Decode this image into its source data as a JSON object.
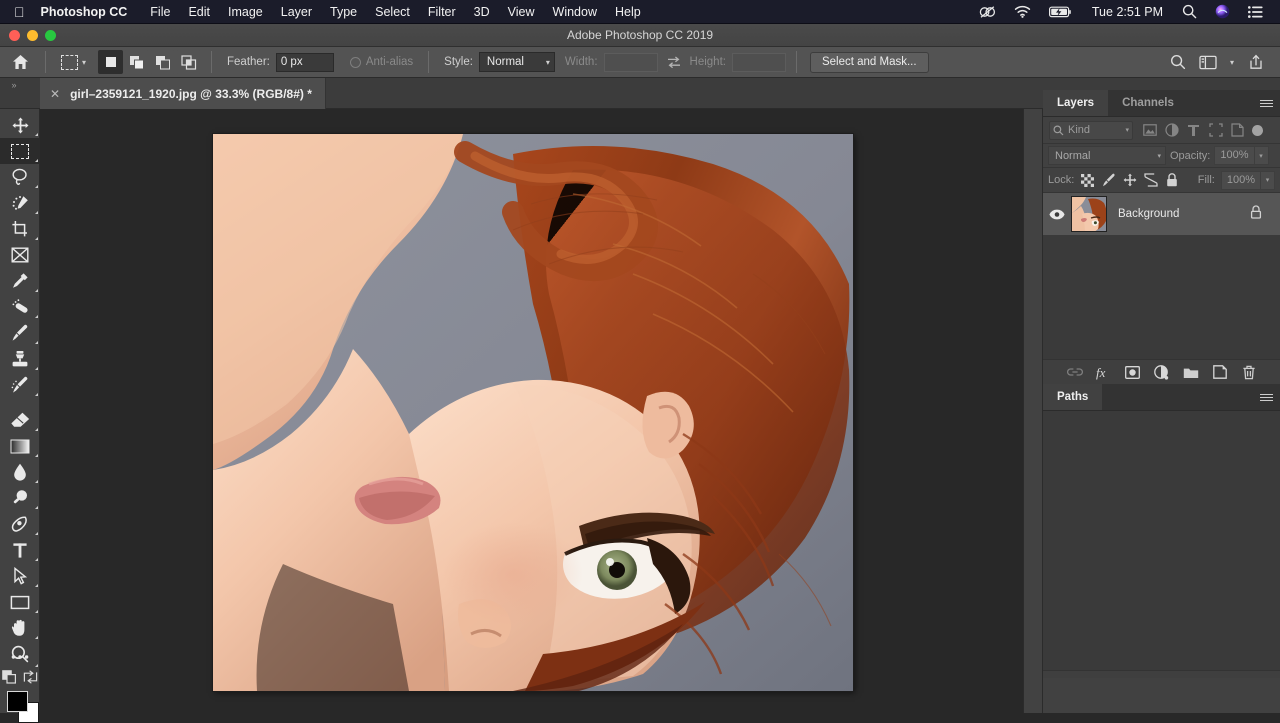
{
  "menubar": {
    "apple_icon": "apple-logo-icon",
    "app_name": "Photoshop CC",
    "items": [
      "File",
      "Edit",
      "Image",
      "Layer",
      "Type",
      "Select",
      "Filter",
      "3D",
      "View",
      "Window",
      "Help"
    ],
    "tray": {
      "creative_cloud_icon": "creative-cloud-icon",
      "wifi_icon": "wifi-icon",
      "battery_icon": "battery-charging-icon",
      "clock": "Tue 2:51 PM",
      "search_icon": "spotlight-search-icon",
      "siri_icon": "siri-icon",
      "notification_icon": "notification-center-icon"
    }
  },
  "titlebar": {
    "title": "Adobe Photoshop CC 2019",
    "close_color": "#ff5f57",
    "minimize_color": "#febc2e",
    "maximize_color": "#28c840"
  },
  "options_bar": {
    "home_icon": "home-icon",
    "active_tool_icon": "rectangular-marquee-icon",
    "tool_chevron_icon": "chevron-down-icon",
    "selection_modes": [
      {
        "name": "new-selection",
        "icon": "new-selection-icon",
        "active": true
      },
      {
        "name": "add-to-selection",
        "icon": "add-to-selection-icon",
        "active": false
      },
      {
        "name": "subtract-from-selection",
        "icon": "subtract-from-selection-icon",
        "active": false
      },
      {
        "name": "intersect-with-selection",
        "icon": "intersect-selection-icon",
        "active": false
      }
    ],
    "feather_label": "Feather:",
    "feather_value": "0 px",
    "antialias_label": "Anti-alias",
    "antialias_enabled": false,
    "style_label": "Style:",
    "style_value": "Normal",
    "width_label": "Width:",
    "width_value": "",
    "swap_icon": "swap-width-height-icon",
    "height_label": "Height:",
    "height_value": "",
    "select_and_mask_label": "Select and Mask...",
    "right_icons": [
      "search-icon",
      "workspace-icon",
      "chevron-down-icon",
      "share-icon"
    ]
  },
  "tab_bar": {
    "expand_icon": "expand-panel-arrows-icon",
    "document": {
      "close_icon": "close-icon",
      "title": "girl–2359121_1920.jpg @ 33.3% (RGB/8#) *"
    }
  },
  "toolbar": {
    "tools": [
      {
        "name": "move-tool",
        "icon": "move-icon",
        "selected": false,
        "has_submenu": true
      },
      {
        "name": "rectangular-marquee-tool",
        "icon": "rectangular-marquee-icon",
        "selected": true,
        "has_submenu": true
      },
      {
        "name": "lasso-tool",
        "icon": "lasso-icon",
        "selected": false,
        "has_submenu": true
      },
      {
        "name": "quick-selection-tool",
        "icon": "quick-selection-icon",
        "selected": false,
        "has_submenu": true
      },
      {
        "name": "crop-tool",
        "icon": "crop-icon",
        "selected": false,
        "has_submenu": true
      },
      {
        "name": "frame-tool",
        "icon": "frame-icon",
        "selected": false,
        "has_submenu": false
      },
      {
        "name": "eyedropper-tool",
        "icon": "eyedropper-icon",
        "selected": false,
        "has_submenu": true
      },
      {
        "name": "spot-healing-brush-tool",
        "icon": "healing-brush-icon",
        "selected": false,
        "has_submenu": true
      },
      {
        "name": "brush-tool",
        "icon": "brush-icon",
        "selected": false,
        "has_submenu": true
      },
      {
        "name": "clone-stamp-tool",
        "icon": "clone-stamp-icon",
        "selected": false,
        "has_submenu": true
      },
      {
        "name": "history-brush-tool",
        "icon": "history-brush-icon",
        "selected": false,
        "has_submenu": true
      },
      {
        "name": "eraser-tool",
        "icon": "eraser-icon",
        "selected": false,
        "has_submenu": true
      },
      {
        "name": "gradient-tool",
        "icon": "gradient-icon",
        "selected": false,
        "has_submenu": true
      },
      {
        "name": "blur-tool",
        "icon": "blur-droplet-icon",
        "selected": false,
        "has_submenu": true
      },
      {
        "name": "dodge-tool",
        "icon": "dodge-icon",
        "selected": false,
        "has_submenu": true
      },
      {
        "name": "pen-tool",
        "icon": "pen-icon",
        "selected": false,
        "has_submenu": true
      },
      {
        "name": "type-tool",
        "icon": "type-t-icon",
        "selected": false,
        "has_submenu": true
      },
      {
        "name": "path-selection-tool",
        "icon": "path-selection-arrow-icon",
        "selected": false,
        "has_submenu": true
      },
      {
        "name": "rectangle-tool",
        "icon": "rectangle-icon",
        "selected": false,
        "has_submenu": true
      },
      {
        "name": "hand-tool",
        "icon": "hand-icon",
        "selected": false,
        "has_submenu": true
      },
      {
        "name": "zoom-tool",
        "icon": "zoom-magnifier-icon",
        "selected": false,
        "has_submenu": false
      },
      {
        "name": "edit-toolbar-more",
        "icon": "ellipsis-more-tools-icon",
        "selected": false,
        "has_submenu": true
      }
    ],
    "quick_mask_icon": "quick-mask-icon",
    "screen_mode_icon": "screen-mode-icon",
    "foreground_color": "#000000",
    "background_color": "#ffffff"
  },
  "canvas": {
    "zoom": "33.3%",
    "background_color": "#8a8d98",
    "document_name": "girl–2359121_1920.jpg",
    "image_description": "Rotated portrait photograph of a red-haired woman lying down against a gray studio backdrop"
  },
  "panels": {
    "layers_panel": {
      "tabs": [
        {
          "name": "tab-layers",
          "label": "Layers",
          "active": true
        },
        {
          "name": "tab-channels",
          "label": "Channels",
          "active": false
        }
      ],
      "menu_icon": "panel-menu-icon",
      "filter": {
        "search_icon": "search-icon",
        "kind_label": "Kind",
        "kind_chevron_icon": "chevron-down-icon",
        "filter_icons": [
          "pixel-layer-filter-icon",
          "adjustment-layer-filter-icon",
          "type-layer-filter-icon",
          "shape-layer-filter-icon",
          "smart-object-filter-icon"
        ],
        "toggle_icon": "filter-toggle-icon"
      },
      "blend_mode": "Normal",
      "blend_chevron_icon": "chevron-down-icon",
      "opacity_label": "Opacity:",
      "opacity_value": "100%",
      "opacity_stepper_icon": "chevron-down-icon",
      "lock_label": "Lock:",
      "lock_icons": [
        "lock-transparent-pixels-icon",
        "lock-image-pixels-icon",
        "lock-position-icon",
        "lock-artboard-nesting-icon",
        "lock-all-icon"
      ],
      "fill_label": "Fill:",
      "fill_value": "100%",
      "fill_stepper_icon": "chevron-down-icon",
      "layers": [
        {
          "name": "Background",
          "visible": true,
          "locked": true,
          "active": true,
          "eye_icon": "eye-visible-icon",
          "lock_icon": "lock-icon",
          "thumbnail": "layer-thumbnail"
        }
      ],
      "footer_icons": [
        "link-layers-icon",
        "layer-style-fx-icon",
        "add-layer-mask-icon",
        "new-adjustment-layer-icon",
        "new-group-icon",
        "new-layer-icon",
        "delete-layer-icon"
      ]
    },
    "paths_panel": {
      "tabs": [
        {
          "name": "tab-paths",
          "label": "Paths",
          "active": true
        }
      ],
      "menu_icon": "panel-menu-icon",
      "paths": []
    }
  }
}
